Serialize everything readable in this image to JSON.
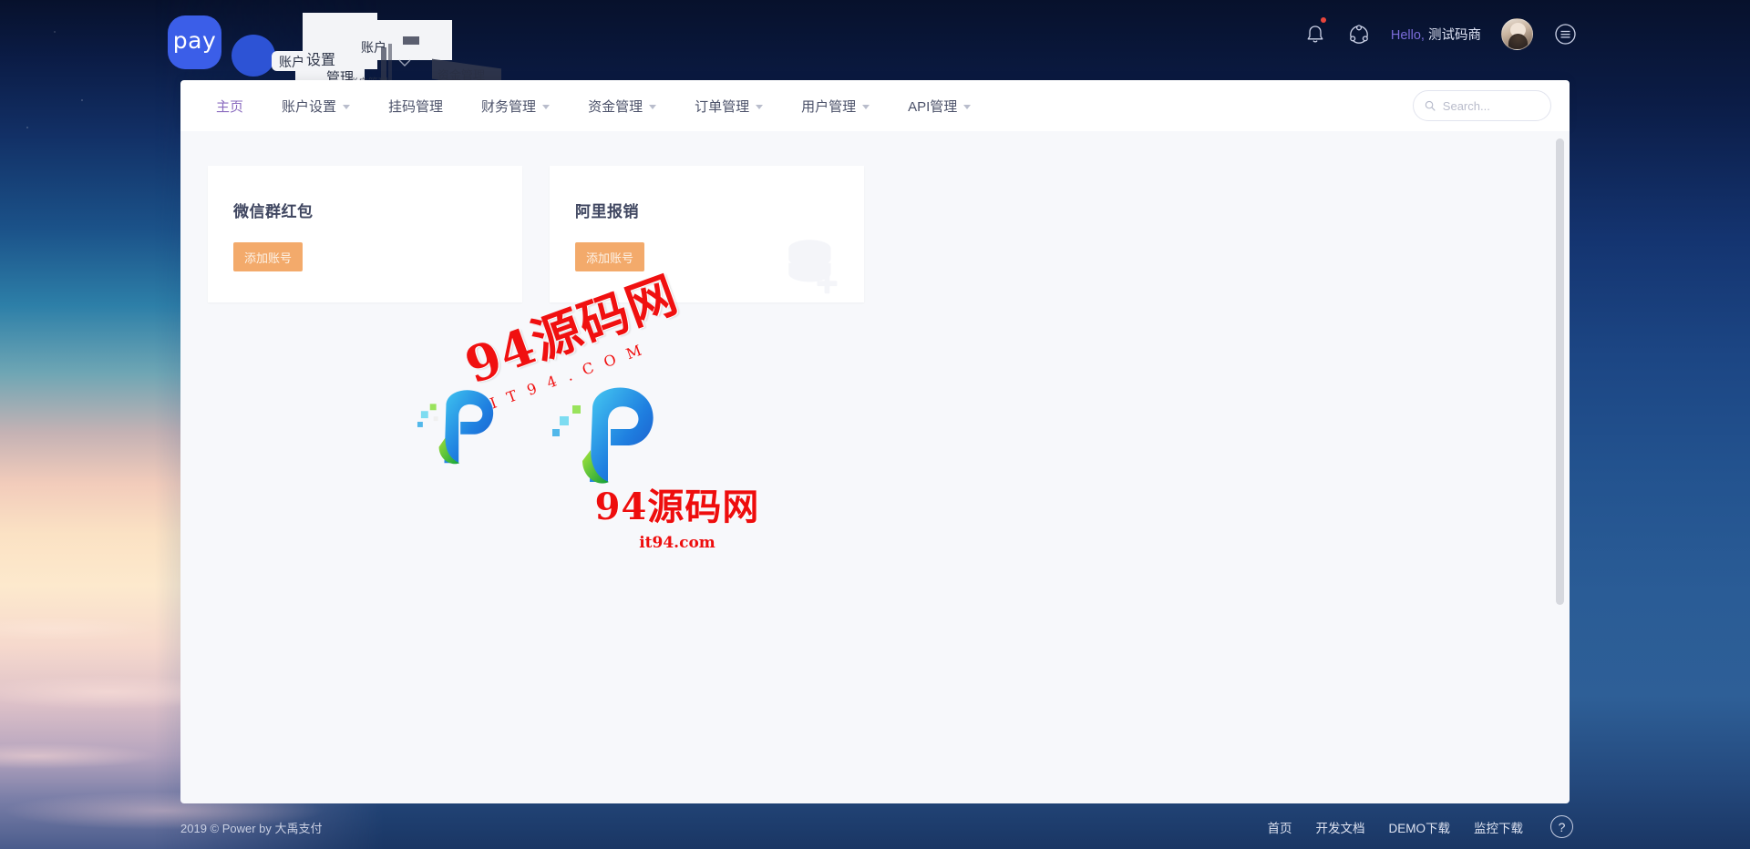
{
  "brand": {
    "logo_text": "pay",
    "accent_blue": "#3b5ee8",
    "accent_orange": "#f3aa6b",
    "active_nav_color": "#8a6bbf"
  },
  "header": {
    "greeting_prefix": "Hello, ",
    "user_name": "测试码商",
    "icons": {
      "bell": "bell-icon",
      "share": "share-nodes-icon",
      "avatar": "user-avatar",
      "menu": "hamburger-menu-icon"
    }
  },
  "nav": {
    "items": [
      {
        "label": "主页",
        "active": true,
        "has_caret": false
      },
      {
        "label": "账户设置",
        "active": false,
        "has_caret": true
      },
      {
        "label": "挂码管理",
        "active": false,
        "has_caret": false
      },
      {
        "label": "财务管理",
        "active": false,
        "has_caret": true
      },
      {
        "label": "资金管理",
        "active": false,
        "has_caret": true
      },
      {
        "label": "订单管理",
        "active": false,
        "has_caret": true
      },
      {
        "label": "用户管理",
        "active": false,
        "has_caret": true
      },
      {
        "label": "API管理",
        "active": false,
        "has_caret": true
      }
    ]
  },
  "search": {
    "placeholder": "Search...",
    "value": ""
  },
  "main": {
    "cards": [
      {
        "title": "微信群红包",
        "button_label": "添加账号"
      },
      {
        "title": "阿里报销",
        "button_label": "添加账号"
      }
    ]
  },
  "watermarks": {
    "rotated": {
      "main": "94源码网",
      "sub": "IT94.COM"
    },
    "big": {
      "main": "94源码网",
      "sub": "it94.com"
    }
  },
  "glitch_fragments": [
    "账户设置",
    "挂码管理",
    "账户管理",
    "资金管理",
    "账户",
    "设置",
    "管理"
  ],
  "footer": {
    "copyright": "2019 © Power by 大禹支付",
    "links": [
      "首页",
      "开发文档",
      "DEMO下载",
      "监控下载"
    ],
    "help_glyph": "?"
  }
}
